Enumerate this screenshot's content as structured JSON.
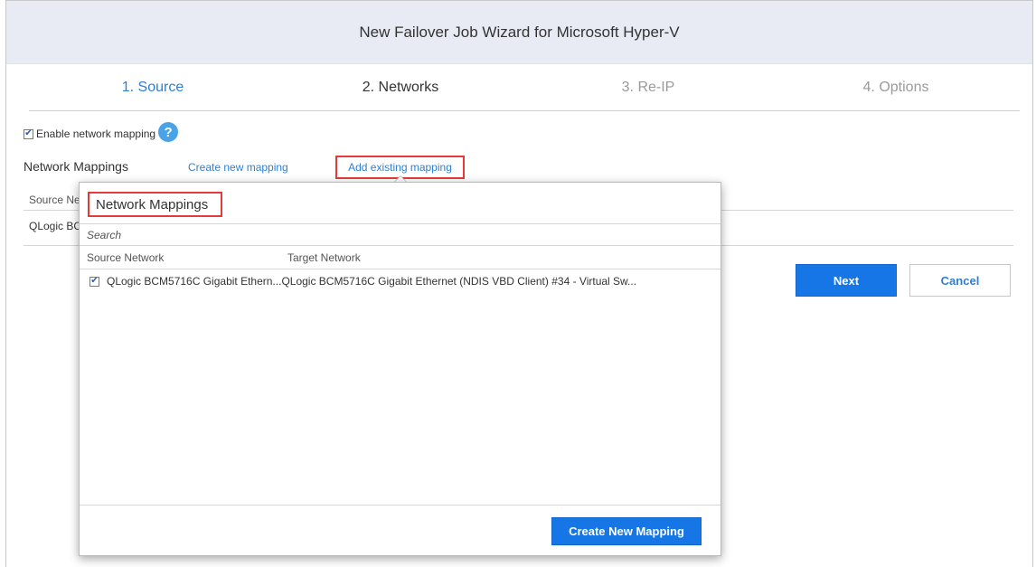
{
  "window": {
    "title": "New Failover Job Wizard for Microsoft Hyper-V"
  },
  "steps": [
    {
      "label": "1. Source",
      "state": "done"
    },
    {
      "label": "2. Networks",
      "state": "active"
    },
    {
      "label": "3. Re-IP",
      "state": "future"
    },
    {
      "label": "4. Options",
      "state": "future"
    }
  ],
  "networks": {
    "enable_label": "Enable network mapping",
    "enable_checked": true,
    "header": "Network Mappings",
    "create_link": "Create new mapping",
    "add_link": "Add existing mapping",
    "table_head_fragment": "Source Ne",
    "row_fragment": "QLogic BC"
  },
  "buttons": {
    "next": "Next",
    "cancel": "Cancel"
  },
  "popup": {
    "title": "Network Mappings",
    "search_placeholder": "Search",
    "columns": {
      "source": "Source Network",
      "target": "Target Network"
    },
    "rows": [
      {
        "checked": true,
        "source": "QLogic BCM5716C Gigabit Ethern...",
        "target": "QLogic BCM5716C Gigabit Ethernet (NDIS VBD Client) #34 - Virtual Sw..."
      }
    ],
    "create_button": "Create New Mapping"
  },
  "colors": {
    "accent": "#1776e6",
    "link": "#2f7fd1",
    "highlight": "#e23b3b",
    "titlebar": "#e8ebf3"
  }
}
